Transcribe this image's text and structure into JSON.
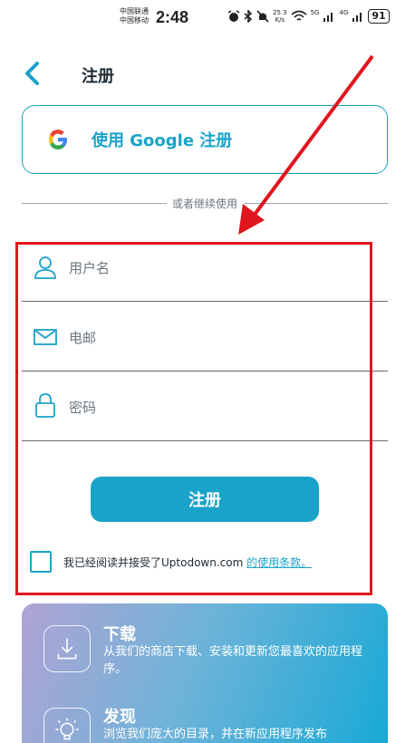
{
  "status_bar": {
    "carrier_1": "中国联通",
    "carrier_2": "中国移动",
    "time": "2:48",
    "net_speed_value": "25.3",
    "net_speed_unit": "K/s",
    "net_5g": "5G",
    "net_4g": "4G",
    "battery": "91",
    "icons": [
      "alarm-icon",
      "bluetooth-icon",
      "mute-icon",
      "wifi-icon",
      "signal-icon",
      "battery-icon"
    ]
  },
  "header": {
    "title": "注册",
    "back_icon": "chevron-left-icon"
  },
  "google_button": {
    "label": "使用 Google 注册",
    "icon": "google-logo-icon"
  },
  "divider": {
    "text": "或者继续使用"
  },
  "form": {
    "username_placeholder": "用户名",
    "email_placeholder": "电邮",
    "password_placeholder": "密码",
    "submit_label": "注册",
    "terms_text": "我已经阅读并接受了Uptodown.com ",
    "terms_link": "的使用条款。"
  },
  "promo": {
    "items": [
      {
        "title": "下载",
        "description": "从我们的商店下载、安装和更新您最喜欢的应用程序。",
        "icon": "download-icon"
      },
      {
        "title": "发现",
        "description": "浏览我们庞大的目录，并在新应用程序发布",
        "icon": "lightbulb-icon"
      }
    ]
  },
  "colors": {
    "accent": "#1aa3c8",
    "annotation": "#e0161e",
    "text": "#1e2a33"
  }
}
